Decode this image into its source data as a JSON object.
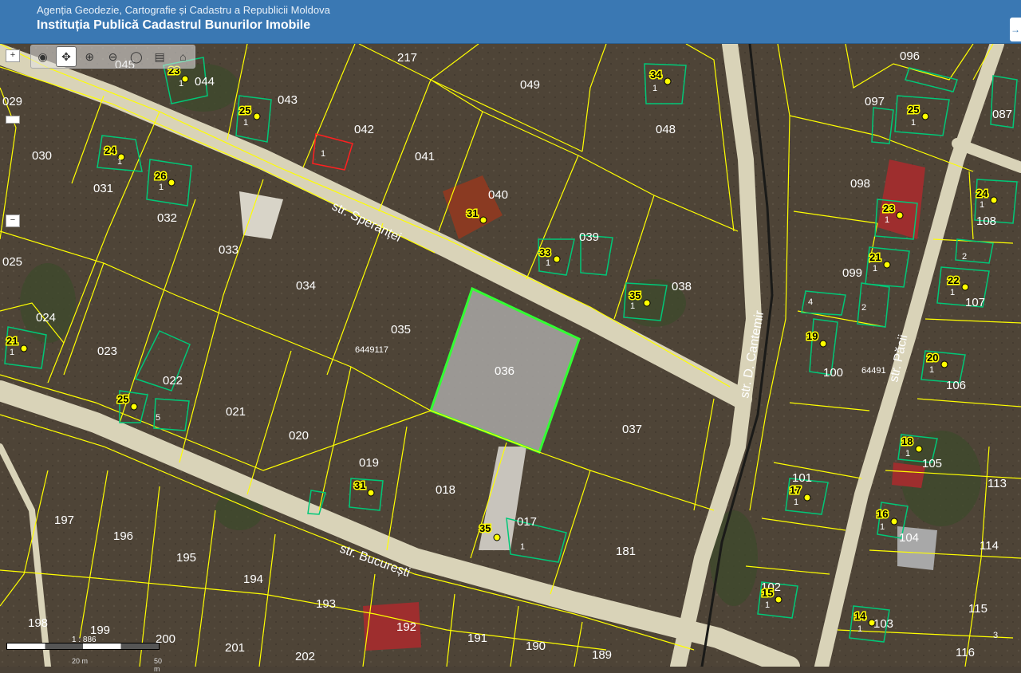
{
  "header": {
    "agency": "Agenția Geodezie, Cartografie și Cadastru a Republicii Moldova",
    "institution": "Instituția Publică Cadastrul Bunurilor Imobile"
  },
  "streets": {
    "sperantei": "str. Speranței",
    "bucuresti": "str. București",
    "cantemir": "str. D. Cantemir",
    "paci": "str. Păcii"
  },
  "parcels": {
    "p217": "217",
    "p049": "049",
    "p048": "048",
    "p096": "096",
    "p097": "097",
    "p087": "087",
    "p029": "029",
    "p030": "030",
    "p031": "031",
    "p032": "032",
    "p033": "033",
    "p034": "034",
    "p035": "035",
    "p036": "036",
    "p037": "037",
    "p038": "038",
    "p039": "039",
    "p040": "040",
    "p041": "041",
    "p042": "042",
    "p043": "043",
    "p044": "044",
    "p045": "045",
    "p098": "098",
    "p099": "099",
    "p100": "100",
    "p101": "101",
    "p102": "102",
    "p103": "103",
    "p104": "104",
    "p105": "105",
    "p106": "106",
    "p107": "107",
    "p108": "108",
    "p113": "113",
    "p114": "114",
    "p115": "115",
    "p116": "116",
    "p025": "025",
    "p024": "024",
    "p023": "023",
    "p022": "022",
    "p021": "021",
    "p020": "020",
    "p019": "019",
    "p018": "018",
    "p017": "017",
    "p181": "181",
    "p197": "197",
    "p196": "196",
    "p195": "195",
    "p194": "194",
    "p193": "193",
    "p192": "192",
    "p191": "191",
    "p190": "190",
    "p189": "189",
    "p198": "198",
    "p199": "199",
    "p200": "200",
    "p201": "201",
    "p202": "202",
    "code1": "6449117",
    "code2": "64491"
  },
  "house_numbers": {
    "h23a": "23",
    "h25a": "25",
    "h24a": "24",
    "h26": "26",
    "h31a": "31",
    "h34": "34",
    "h25b": "25",
    "h33": "33",
    "h35a": "35",
    "h21a": "21",
    "h25c": "25",
    "h31b": "31",
    "h35b": "35",
    "h24b": "24",
    "h23b": "23",
    "h21b": "21",
    "h22": "22",
    "h19": "19",
    "h20": "20",
    "h18": "18",
    "h17": "17",
    "h16": "16",
    "h15": "15",
    "h14": "14"
  },
  "building_subs": {
    "one": "1",
    "two": "2",
    "three": "3",
    "four": "4",
    "five": "5"
  },
  "controls": {
    "zoom_in": "+",
    "zoom_mid": "",
    "zoom_out": "−",
    "scale_ratio": "1 : 886",
    "scale_20": "20 m",
    "scale_50": "50 m",
    "header_button": "→"
  },
  "colors": {
    "parcel_line": "#ffff00",
    "building": "#00c878",
    "selected": "#33ff33",
    "road": "#d9d3b8",
    "header": "#3a78b3"
  }
}
